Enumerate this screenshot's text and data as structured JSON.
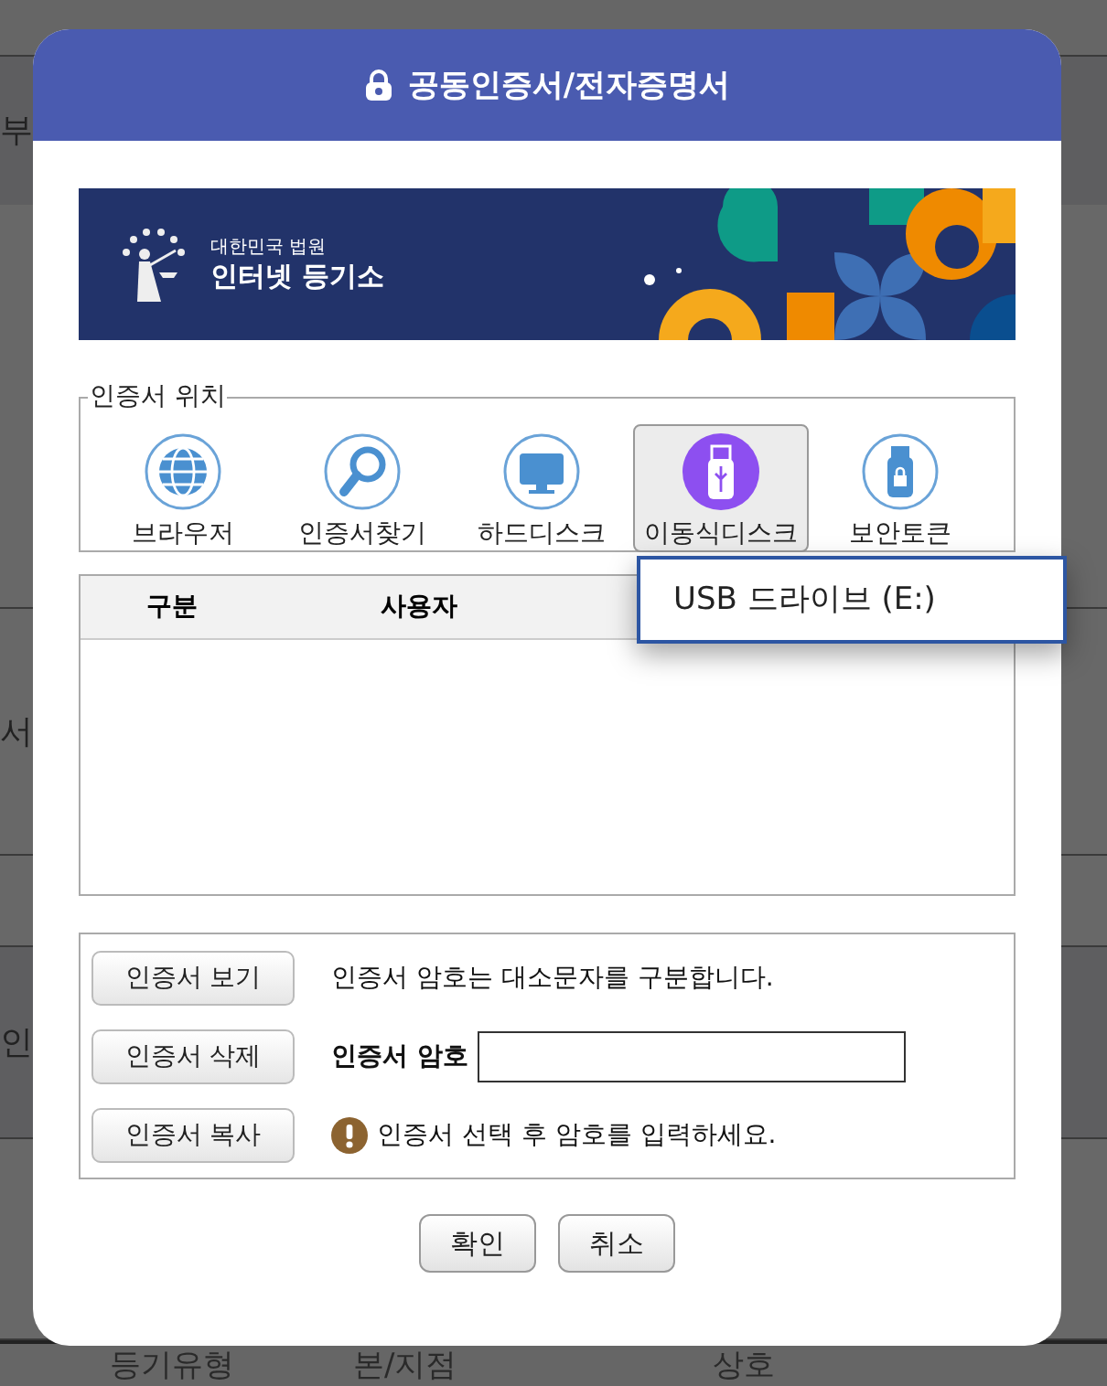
{
  "background": {
    "rows": [
      {
        "text": "부"
      },
      {
        "text": "서"
      },
      {
        "text": "인"
      }
    ],
    "footer_columns": [
      "등기유형",
      "본/지점",
      "상호"
    ]
  },
  "dialog": {
    "title": "공동인증서/전자증명서",
    "banner": {
      "subtitle": "대한민국 법원",
      "title": "인터넷 등기소"
    },
    "location": {
      "legend": "인증서 위치",
      "items": [
        {
          "kind": "globe",
          "label": "브라우저",
          "selected": false
        },
        {
          "kind": "search",
          "label": "인증서찾기",
          "selected": false
        },
        {
          "kind": "monitor",
          "label": "하드디스크",
          "selected": false
        },
        {
          "kind": "usb",
          "label": "이동식디스크",
          "selected": true
        },
        {
          "kind": "token",
          "label": "보안토큰",
          "selected": false
        }
      ],
      "dropdown": {
        "items": [
          "USB 드라이브 (E:)"
        ]
      }
    },
    "table": {
      "columns": [
        "구분",
        "사용자"
      ]
    },
    "actions": {
      "buttons": [
        "인증서 보기",
        "인증서 삭제",
        "인증서 복사"
      ],
      "notice": "인증서 암호는 대소문자를 구분합니다.",
      "password_label": "인증서 암호",
      "warning": "인증서 선택 후 암호를 입력하세요."
    },
    "footer_buttons": [
      "확인",
      "취소"
    ]
  }
}
